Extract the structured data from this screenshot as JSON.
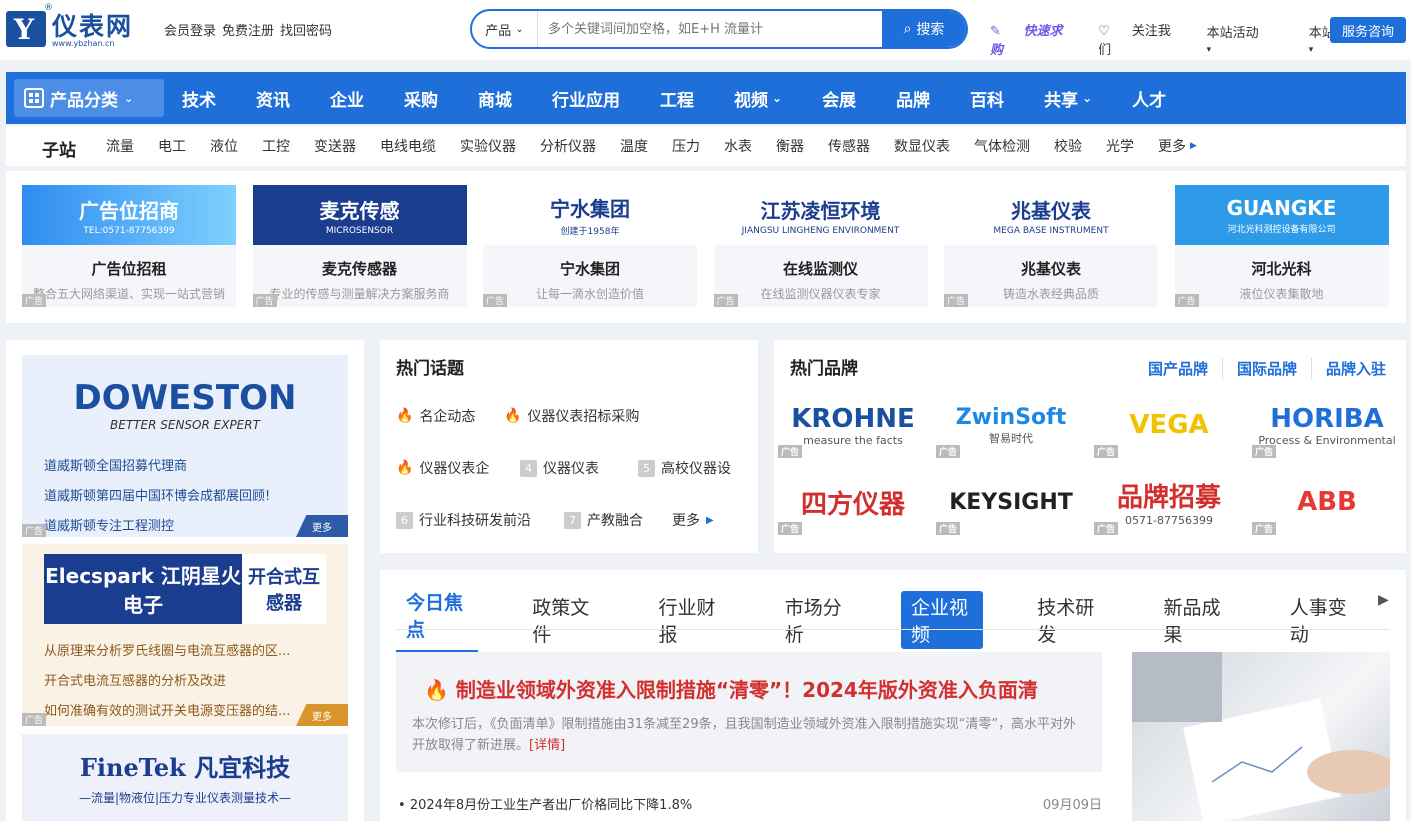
{
  "header": {
    "logo_name": "仪表网",
    "logo_url": "www.ybzhan.cn",
    "logo_reg": "®",
    "login": "会员登录",
    "register": "免费注册",
    "find_password": "找回密码",
    "search_category": "产品",
    "search_placeholder": "多个关键词间加空格，如E+H 流量计",
    "search_button": "搜索",
    "quick_buy": "快速求购",
    "follow": "关注我们",
    "activities": "本站活动",
    "services": "本站服务",
    "consult": "服务咨询"
  },
  "nav": {
    "category": "产品分类",
    "items": [
      "技术",
      "资讯",
      "企业",
      "采购",
      "商城",
      "行业应用",
      "工程",
      "视频",
      "会展",
      "品牌",
      "百科",
      "共享",
      "人才"
    ]
  },
  "substation": {
    "label": "子站",
    "items": [
      "流量",
      "电工",
      "液位",
      "工控",
      "变送器",
      "电线电缆",
      "实验仪器",
      "分析仪器",
      "温度",
      "压力",
      "水表",
      "衡器",
      "传感器",
      "数显仪表",
      "气体检测",
      "校验",
      "光学",
      "更多"
    ]
  },
  "ads": [
    {
      "banner": "广告位招商",
      "banner_sub": "TEL:0571-87756399",
      "title": "广告位招租",
      "sub": "整合五大网络渠道、实现一站式营销",
      "tag": "广告"
    },
    {
      "banner": "麦克传感",
      "banner_sub": "MICROSENSOR",
      "title": "麦克传感器",
      "sub": "专业的传感与测量解决方案服务商",
      "tag": "广告"
    },
    {
      "banner": "宁水集团",
      "banner_sub": "创建于1958年",
      "title": "宁水集团",
      "sub": "让每一滴水创造价值",
      "tag": "广告"
    },
    {
      "banner": "江苏凌恒环境",
      "banner_sub": "JIANGSU LINGHENG ENVIRONMENT",
      "title": "在线监测仪",
      "sub": "在线监测仪器仪表专家",
      "tag": "广告"
    },
    {
      "banner": "兆基仪表",
      "banner_sub": "MEGA BASE INSTRUMENT",
      "title": "兆基仪表",
      "sub": "铸造水表经典品质",
      "tag": "广告"
    },
    {
      "banner": "GUANGKE",
      "banner_sub": "河北光科测控设备有限公司",
      "title": "河北光科",
      "sub": "液位仪表集散地",
      "tag": "广告"
    }
  ],
  "left_ads": [
    {
      "logo": "DOWESTON",
      "logo_sub": "BETTER SENSOR EXPERT",
      "items": [
        "道威斯顿全国招募代理商",
        "道威斯顿第四届中国环博会成都展回顾!",
        "道威斯顿专注工程测控"
      ],
      "more": "更多",
      "tag": "广告"
    },
    {
      "logo": "Elecspark 江阴星火电子",
      "logo_sub": "开合式互感器",
      "items": [
        "从原理来分析罗氏线圈与电流互感器的区...",
        "开合式电流互感器的分析及改进",
        "如何准确有效的测试开关电源变压器的结..."
      ],
      "more": "更多",
      "tag": "广告"
    },
    {
      "logo": "FineTek 凡宜科技",
      "logo_sub": "—流量|物液位|压力专业仪表测量技术—",
      "items": [],
      "more": "",
      "tag": ""
    }
  ],
  "hot": {
    "title": "热门话题",
    "topics": [
      {
        "n": "",
        "label": "名企动态"
      },
      {
        "n": "",
        "label": "仪器仪表招标采购"
      },
      {
        "n": "",
        "label": "仪器仪表企"
      },
      {
        "n": "4",
        "label": "仪器仪表"
      },
      {
        "n": "5",
        "label": "高校仪器设"
      },
      {
        "n": "6",
        "label": "行业科技研发前沿"
      },
      {
        "n": "7",
        "label": "产教融合"
      }
    ],
    "more": "更多"
  },
  "brands": {
    "title": "热门品牌",
    "links": [
      "国产品牌",
      "国际品牌",
      "品牌入驻"
    ],
    "items": [
      {
        "name": "KROHNE",
        "sub": "measure the facts",
        "color": "#1b4fa0"
      },
      {
        "name": "ZwinSoft",
        "sub": "智易时代",
        "color": "#1e88e5"
      },
      {
        "name": "VEGA",
        "sub": "",
        "color": "#f2c200"
      },
      {
        "name": "HORIBA",
        "sub": "Process & Environmental",
        "color": "#1e6fd9"
      },
      {
        "name": "四方仪器",
        "sub": "",
        "color": "#d32f2f"
      },
      {
        "name": "KEYSIGHT",
        "sub": "",
        "color": "#222222"
      },
      {
        "name": "品牌招募",
        "sub": "0571-87756399",
        "color": "#d32f2f"
      },
      {
        "name": "ABB",
        "sub": "",
        "color": "#e53935"
      }
    ],
    "tag": "广告"
  },
  "news": {
    "tabs": [
      "今日焦点",
      "政策文件",
      "行业财报",
      "市场分析",
      "企业视频",
      "技术研发",
      "新品成果",
      "人事变动"
    ],
    "featured_title": "制造业领域外资准入限制措施“清零”！2024年版外资准入负面清",
    "featured_desc": "本次修订后，《负面清单》限制措施由31条减至29条，且我国制造业领域外资准入限制措施实现“清零”，高水平对外开放取得了新进展。",
    "featured_link": "[详情]",
    "items": [
      {
        "title": "2024年8月份工业生产者出厂价格同比下降1.8%",
        "date": "09月09日"
      }
    ]
  }
}
